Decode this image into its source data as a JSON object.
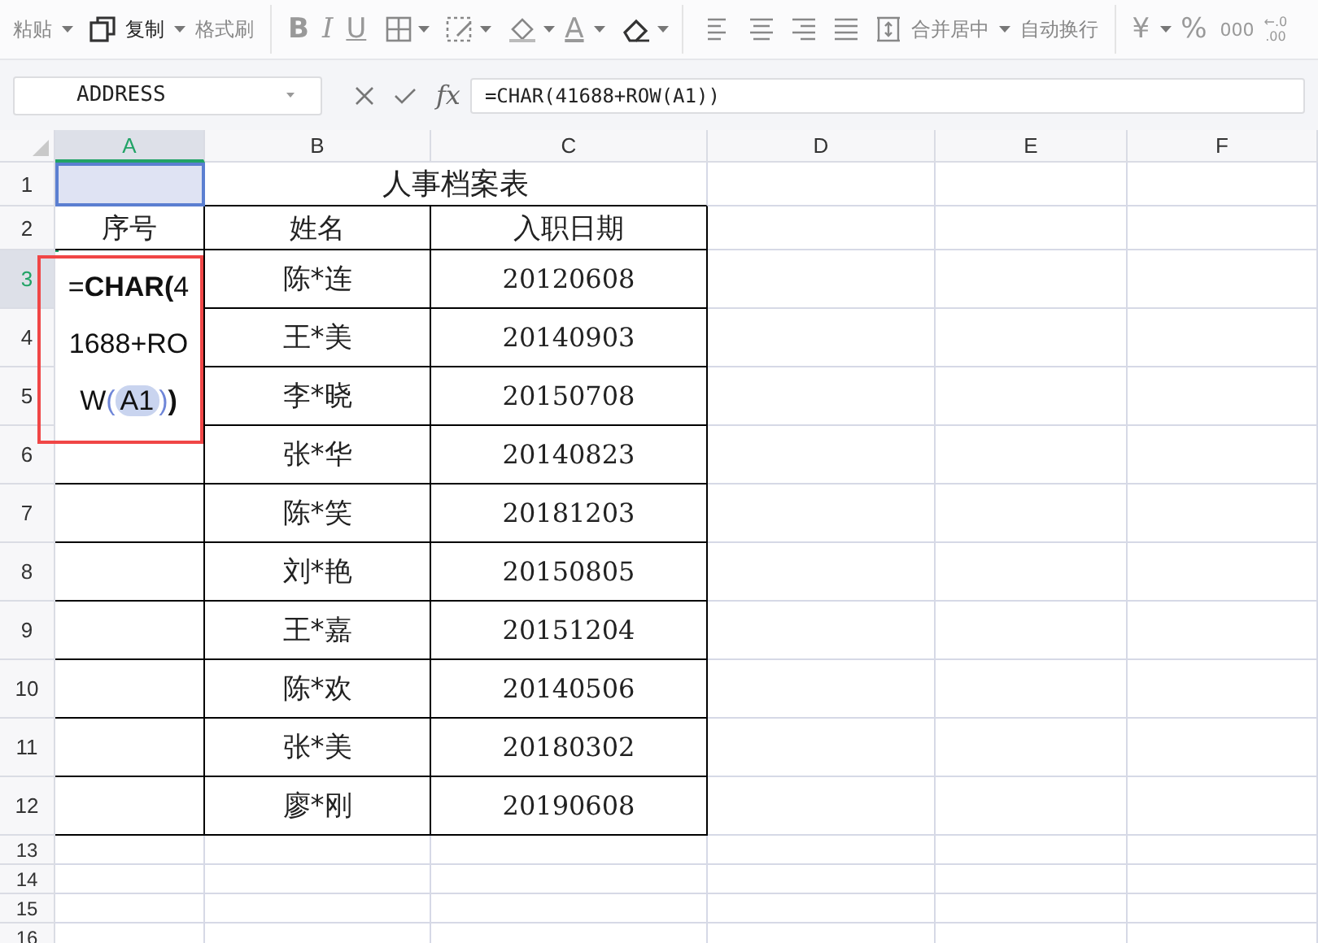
{
  "toolbar": {
    "paste": "粘贴",
    "copy": "复制",
    "format_painter": "格式刷",
    "bold": "B",
    "italic": "I",
    "underline": "U",
    "font_color": "A",
    "merge": "合并居中",
    "wrap": "自动换行",
    "currency": "¥",
    "percent": "%",
    "thousands": "000",
    "decimals_more": "←.0",
    "decimals_less": ".00"
  },
  "name_box": "ADDRESS",
  "formula_label": "fx",
  "formula": "=CHAR(41688+ROW(A1))",
  "columns": [
    {
      "label": "A",
      "selected": true
    },
    {
      "label": "B",
      "selected": false
    },
    {
      "label": "C",
      "selected": false
    },
    {
      "label": "D",
      "selected": false
    },
    {
      "label": "E",
      "selected": false
    },
    {
      "label": "F",
      "selected": false
    }
  ],
  "rows": [
    {
      "label": "1",
      "selected": false
    },
    {
      "label": "2",
      "selected": false
    },
    {
      "label": "3",
      "selected": true
    },
    {
      "label": "4",
      "selected": false
    },
    {
      "label": "5",
      "selected": false
    },
    {
      "label": "6",
      "selected": false
    },
    {
      "label": "7",
      "selected": false
    },
    {
      "label": "8",
      "selected": false
    },
    {
      "label": "9",
      "selected": false
    },
    {
      "label": "10",
      "selected": false
    },
    {
      "label": "11",
      "selected": false
    },
    {
      "label": "12",
      "selected": false
    },
    {
      "label": "13",
      "selected": false
    },
    {
      "label": "14",
      "selected": false
    },
    {
      "label": "15",
      "selected": false
    },
    {
      "label": "16",
      "selected": false
    }
  ],
  "title": "人事档案表",
  "headers": [
    "序号",
    "姓名",
    "入职日期"
  ],
  "records": [
    {
      "name": "陈*连",
      "date": "20120608"
    },
    {
      "name": "王*美",
      "date": "20140903"
    },
    {
      "name": "李*晓",
      "date": "20150708"
    },
    {
      "name": "张*华",
      "date": "20140823"
    },
    {
      "name": "陈*笑",
      "date": "20181203"
    },
    {
      "name": "刘*艳",
      "date": "20150805"
    },
    {
      "name": "王*嘉",
      "date": "20151204"
    },
    {
      "name": "陈*欢",
      "date": "20140506"
    },
    {
      "name": "张*美",
      "date": "20180302"
    },
    {
      "name": "廖*刚",
      "date": "20190608"
    }
  ],
  "editor": {
    "segments": [
      {
        "text": "=",
        "kind": "plain"
      },
      {
        "text": "CHAR(",
        "kind": "bold"
      },
      {
        "text": "41688+ROW",
        "kind": "plain"
      },
      {
        "text": "(",
        "kind": "paren"
      },
      {
        "text": "A1",
        "kind": "ref"
      },
      {
        "text": ")",
        "kind": "paren"
      },
      {
        "text": ")",
        "kind": "bold"
      }
    ]
  }
}
